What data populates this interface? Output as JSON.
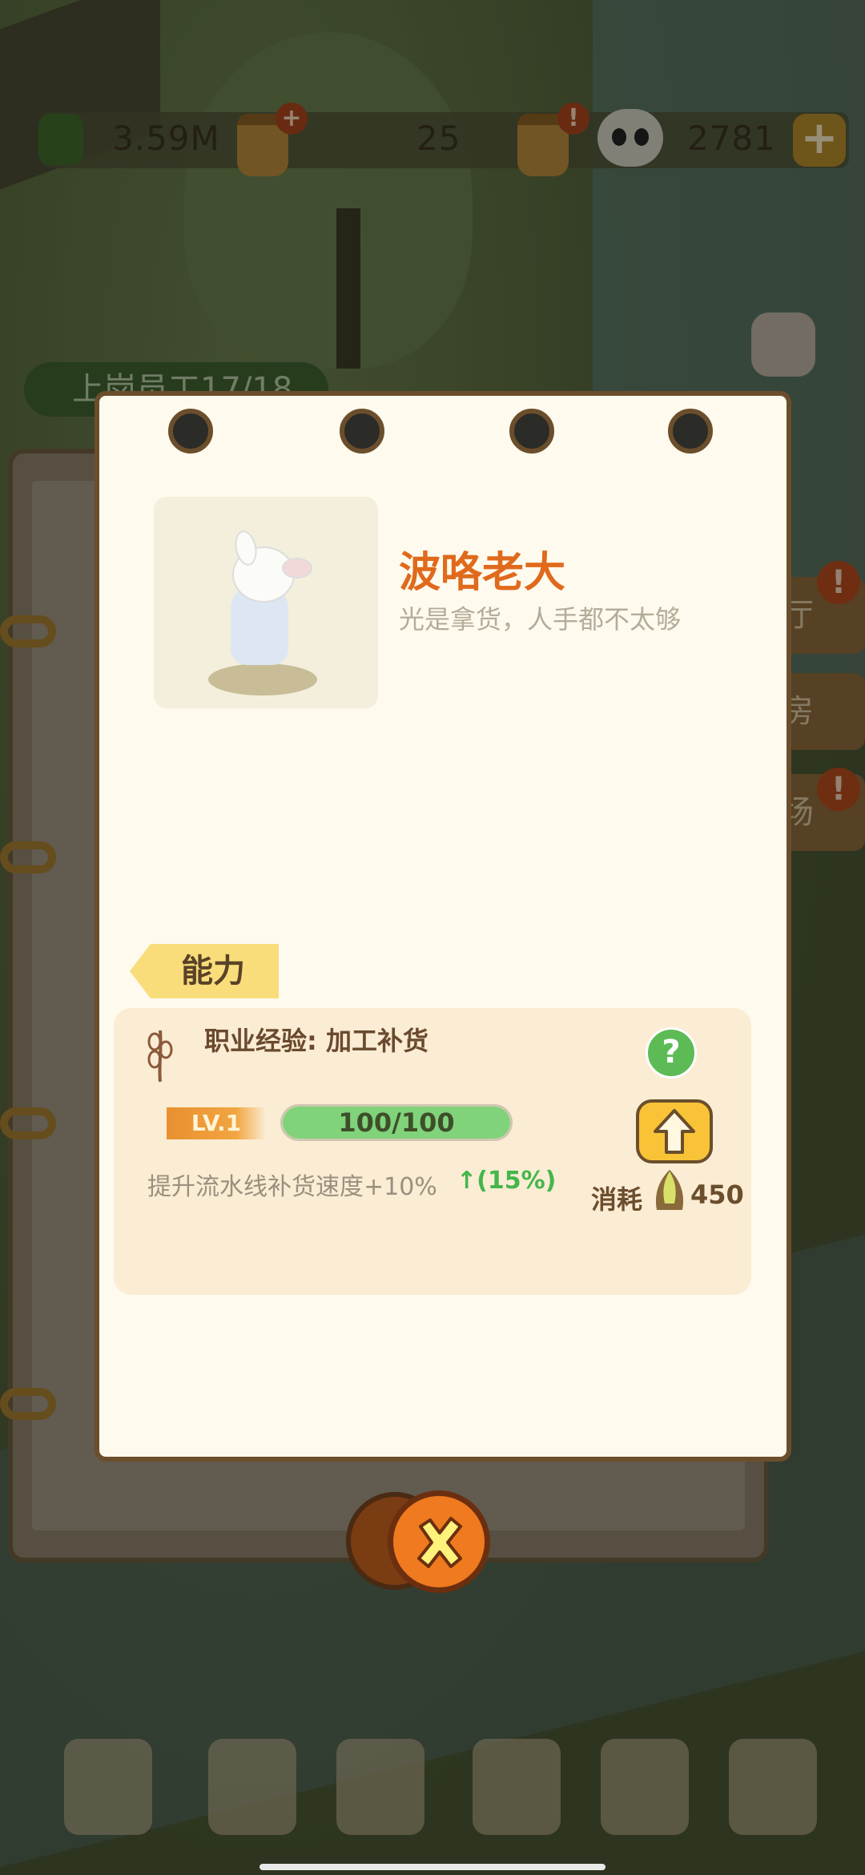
{
  "resources": {
    "bamboo": "3.59M",
    "jar_badge": "+",
    "shoots": "25",
    "jar2_badge": "!",
    "pandas": "2781",
    "plus": "+"
  },
  "background": {
    "staff_status": "上岗员工17/18",
    "side_tabs": [
      "厅",
      "房",
      "场"
    ],
    "side_alert": "!"
  },
  "character": {
    "name": "波咯老大",
    "description": "光是拿货，人手都不太够"
  },
  "ability": {
    "tab_label": "能力",
    "job_label": "职业经验:  加工补货",
    "help": "?",
    "level": "LV.1",
    "xp_current": 100,
    "xp_max": 100,
    "xp_text": "100/100",
    "effect": "提升流水线补货速度+10%",
    "effect_upgrade": "↑(15%)",
    "cost_label": "消耗",
    "cost_value": "450"
  },
  "colors": {
    "accent_orange": "#e06a1c",
    "paper": "#fffaee",
    "card": "#fbecd4",
    "xp_fill": "#80d37a",
    "upgrade": "#f8c336"
  }
}
